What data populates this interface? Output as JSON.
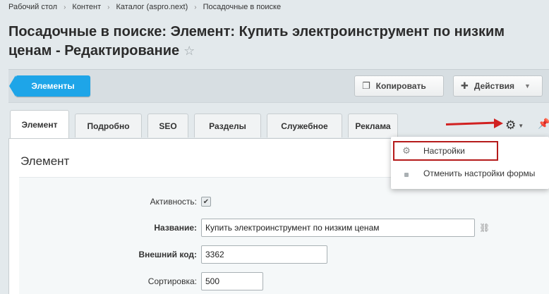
{
  "breadcrumb": [
    "Рабочий стол",
    "Контент",
    "Каталог (aspro.next)",
    "Посадочные в поиске"
  ],
  "page_title": "Посадочные в поиске: Элемент: Купить электроинструмент по низким ценам - Редактирование",
  "toolbar": {
    "elements_label": "Элементы",
    "copy_label": "Копировать",
    "actions_label": "Действия"
  },
  "tabs": [
    "Элемент",
    "Подробно",
    "SEO",
    "Разделы",
    "Служебное",
    "Реклама"
  ],
  "section_title": "Элемент",
  "form": {
    "active_label": "Активность:",
    "name_label": "Название:",
    "name_value": "Купить электроинструмент по низким ценам",
    "external_code_label": "Внешний код:",
    "external_code_value": "3362",
    "sort_label": "Сортировка:",
    "sort_value": "500"
  },
  "settings_menu": {
    "items": [
      "Настройки",
      "Отменить настройки формы"
    ]
  },
  "colors": {
    "accent_blue": "#1ea5e8",
    "highlight_red": "#b51b1b",
    "arrow_red": "#d12121"
  }
}
